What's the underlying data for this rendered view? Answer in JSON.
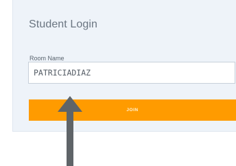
{
  "login": {
    "title": "Student Login",
    "room_label": "Room Name",
    "room_value": "PATRICIADIAZ",
    "join_label": "JOIN"
  },
  "colors": {
    "card_background": "#eef3f9",
    "join_button": "#ff9b00",
    "annotation_arrow": "#5f6468"
  },
  "icons": {
    "annotation": "up-arrow-icon"
  }
}
